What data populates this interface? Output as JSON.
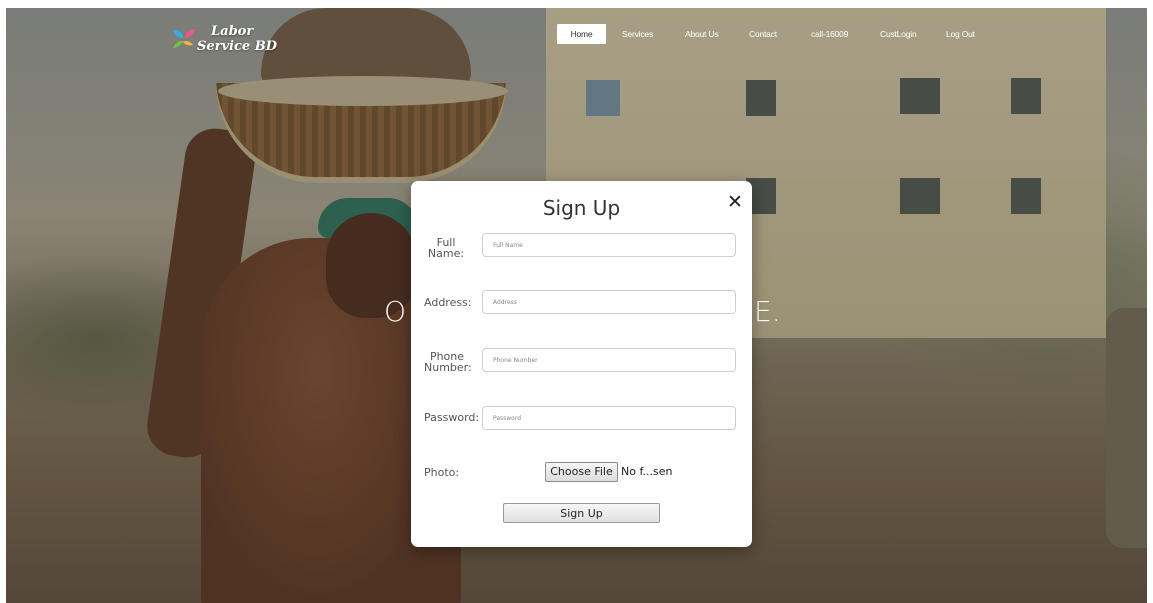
{
  "brand": {
    "line1": "Labor",
    "line2": "Service BD",
    "logo_colors": [
      "#3ea9e0",
      "#f2b43c",
      "#e85a8a",
      "#7ac043"
    ]
  },
  "nav": {
    "items": [
      {
        "label": "Home",
        "active": true
      },
      {
        "label": "Services",
        "active": false
      },
      {
        "label": "About Us",
        "active": false
      },
      {
        "label": "Contact",
        "active": false
      },
      {
        "label": "call-16009",
        "active": false
      },
      {
        "label": "CustLogin",
        "active": false
      },
      {
        "label": "Log Out",
        "active": false
      }
    ]
  },
  "hero": {
    "left_fragment": "O",
    "right_fragment": "E."
  },
  "modal": {
    "title": "Sign Up",
    "close_glyph": "✕",
    "fields": {
      "full_name": {
        "label_line1": "Full",
        "label_line2": "Name:",
        "placeholder": "Full Name",
        "value": ""
      },
      "address": {
        "label": "Address:",
        "placeholder": "Address",
        "value": ""
      },
      "phone": {
        "label_line1": "Phone",
        "label_line2": "Number:",
        "placeholder": "Phone Number",
        "value": ""
      },
      "password": {
        "label": "Password:",
        "placeholder": "Password",
        "value": ""
      }
    },
    "photo": {
      "label": "Photo:",
      "button_label": "Choose File",
      "status": "No f...sen"
    },
    "submit_label": "Sign Up"
  }
}
